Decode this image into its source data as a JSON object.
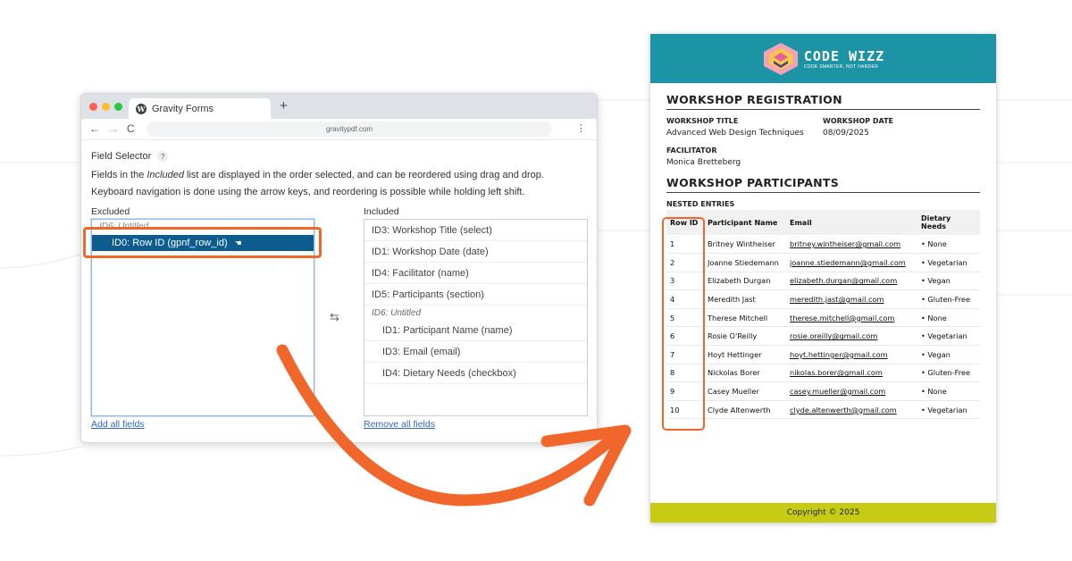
{
  "browser": {
    "tab_title": "Gravity Forms",
    "new_tab_symbol": "+",
    "url": "gravitypdf.com",
    "back_symbol": "←",
    "forward_symbol": "→",
    "reload_symbol": "C",
    "menu_symbol": "⋮"
  },
  "field_selector": {
    "title": "Field Selector",
    "help_symbol": "?",
    "desc_part1": "Fields in the ",
    "desc_italic": "Included",
    "desc_part2": " list are displayed in the order selected, and can be reordered using drag and drop.",
    "desc_line2": "Keyboard navigation is done using the arrow keys, and reordering is possible while holding left shift.",
    "excluded_label": "Excluded",
    "included_label": "Included",
    "excluded_ghost": "ID6: Untitled",
    "excluded_selected": "ID0: Row ID (gpnf_row_id)",
    "included_items": [
      "ID3: Workshop Title (select)",
      "ID1: Workshop Date (date)",
      "ID4: Facilitator (name)",
      "ID5: Participants (section)",
      "ID6: Untitled",
      "ID1: Participant Name (name)",
      "ID3: Email (email)",
      "ID4: Dietary Needs (checkbox)"
    ],
    "swap_symbol": "⇆",
    "add_all": "Add all fields",
    "remove_all": "Remove all fields"
  },
  "pdf": {
    "logo_title": "CODE WIZZ",
    "logo_subtitle": "CODE SMARTER, NOT HARDER",
    "registration_heading": "WORKSHOP REGISTRATION",
    "title_label": "WORKSHOP TITLE",
    "title_value": "Advanced Web Design Techniques",
    "date_label": "WORKSHOP DATE",
    "date_value": "08/09/2025",
    "facilitator_label": "FACILITATOR",
    "facilitator_value": "Monica Bretteberg",
    "participants_heading": "WORKSHOP PARTICIPANTS",
    "nested_label": "NESTED ENTRIES",
    "columns": [
      "Row ID",
      "Participant Name",
      "Email",
      "Dietary Needs"
    ],
    "rows": [
      [
        "1",
        "Britney Wintheiser",
        "britney.wintheiser@gmail.com",
        "• None"
      ],
      [
        "2",
        "Joanne Stiedemann",
        "joanne.stiedemann@gmail.com",
        "• Vegetarian"
      ],
      [
        "3",
        "Elizabeth Durgan",
        "elizabeth.durgan@gmail.com",
        "• Vegan"
      ],
      [
        "4",
        "Meredith Jast",
        "meredith.jast@gmail.com",
        "• Gluten-Free"
      ],
      [
        "5",
        "Therese Mitchell",
        "therese.mitchell@gmail.com",
        "• None"
      ],
      [
        "6",
        "Rosie O'Reilly",
        "rosie.oreilly@gmail.com",
        "• Vegetarian"
      ],
      [
        "7",
        "Hoyt Hettinger",
        "hoyt.hettinger@gmail.com",
        "• Vegan"
      ],
      [
        "8",
        "Nickolas Borer",
        "nikolas.borer@gmail.com",
        "• Gluten-Free"
      ],
      [
        "9",
        "Casey Mueller",
        "casey.mueller@gmail.com",
        "• None"
      ],
      [
        "10",
        "Clyde Altenwerth",
        "clyde.altenwerth@gmail.com",
        "• Vegetarian"
      ]
    ],
    "footer": "Copyright © 2025"
  },
  "colors": {
    "accent_orange": "#f1662a",
    "pdf_header_teal": "#1d93a6",
    "pdf_footer_lime": "#c6cc13",
    "selected_blue": "#0d5c8f"
  }
}
